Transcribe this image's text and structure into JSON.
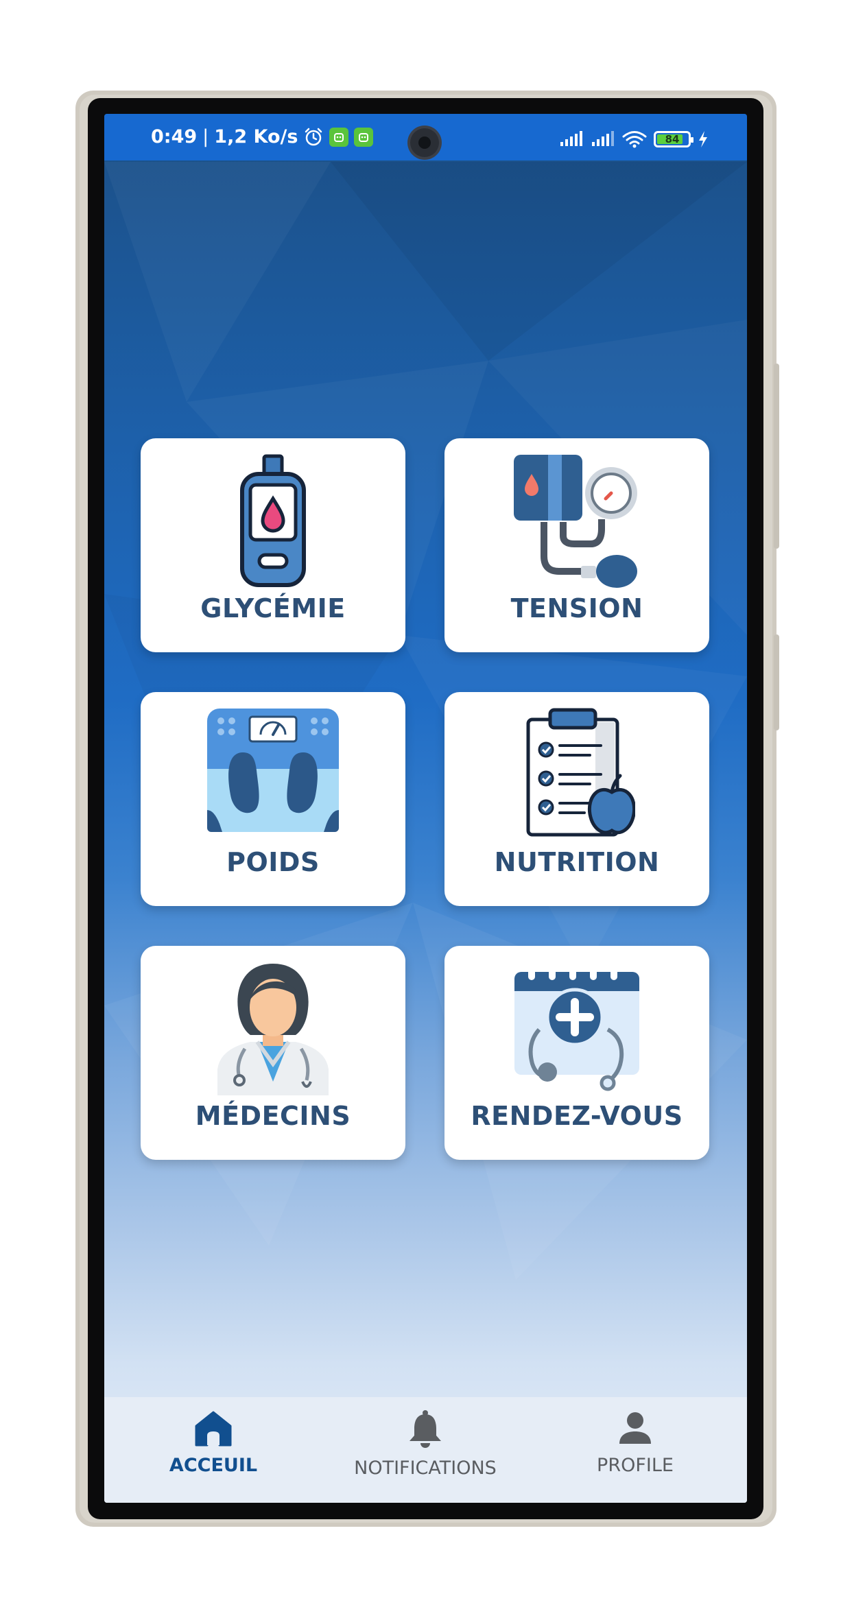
{
  "status_bar": {
    "time": "0:49",
    "separator": "|",
    "speed": "1,2 Ko/s",
    "battery_level": "84",
    "battery_fraction": 0.84,
    "battery_color": "#5bd03d",
    "icons": [
      "alarm-icon",
      "app-badge-icon",
      "app-badge-icon",
      "cell-signal-icon",
      "cell-signal-icon",
      "wifi-icon",
      "battery-icon",
      "charging-icon"
    ]
  },
  "tiles": [
    {
      "label": "GLYCÉMIE",
      "icon": "glucometer-icon"
    },
    {
      "label": "TENSION",
      "icon": "blood-pressure-icon"
    },
    {
      "label": "POIDS",
      "icon": "scale-icon"
    },
    {
      "label": "NUTRITION",
      "icon": "nutrition-checklist-icon"
    },
    {
      "label": "MÉDECINS",
      "icon": "doctor-icon"
    },
    {
      "label": "RENDEZ-VOUS",
      "icon": "appointment-calendar-icon"
    }
  ],
  "bottom_nav": {
    "items": [
      {
        "label": "ACCEUIL",
        "icon": "home-icon",
        "active": true
      },
      {
        "label": "NOTIFICATIONS",
        "icon": "bell-icon",
        "active": false
      },
      {
        "label": "PROFILE",
        "icon": "person-icon",
        "active": false
      }
    ]
  },
  "colors": {
    "status_bar": "#1769d0",
    "label_text": "#2d4f76",
    "nav_active": "#114f8f",
    "nav_inactive": "#5a5d61"
  }
}
